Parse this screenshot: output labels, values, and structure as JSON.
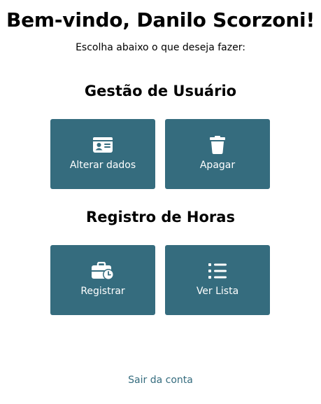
{
  "header": {
    "welcome": "Bem-vindo, Danilo Scorzoni!",
    "subtitle": "Escolha abaixo o que deseja fazer:"
  },
  "sections": [
    {
      "title": "Gestão de Usuário",
      "actions": [
        {
          "label": "Alterar dados",
          "icon": "id-card-icon"
        },
        {
          "label": "Apagar",
          "icon": "trash-icon"
        }
      ]
    },
    {
      "title": "Registro de Horas",
      "actions": [
        {
          "label": "Registrar",
          "icon": "briefcase-clock-icon"
        },
        {
          "label": "Ver Lista",
          "icon": "list-icon"
        }
      ]
    }
  ],
  "footer": {
    "logout_label": "Sair da conta"
  },
  "colors": {
    "tile_background": "#356c7e",
    "tile_text": "#ffffff",
    "link": "#356c7e"
  }
}
